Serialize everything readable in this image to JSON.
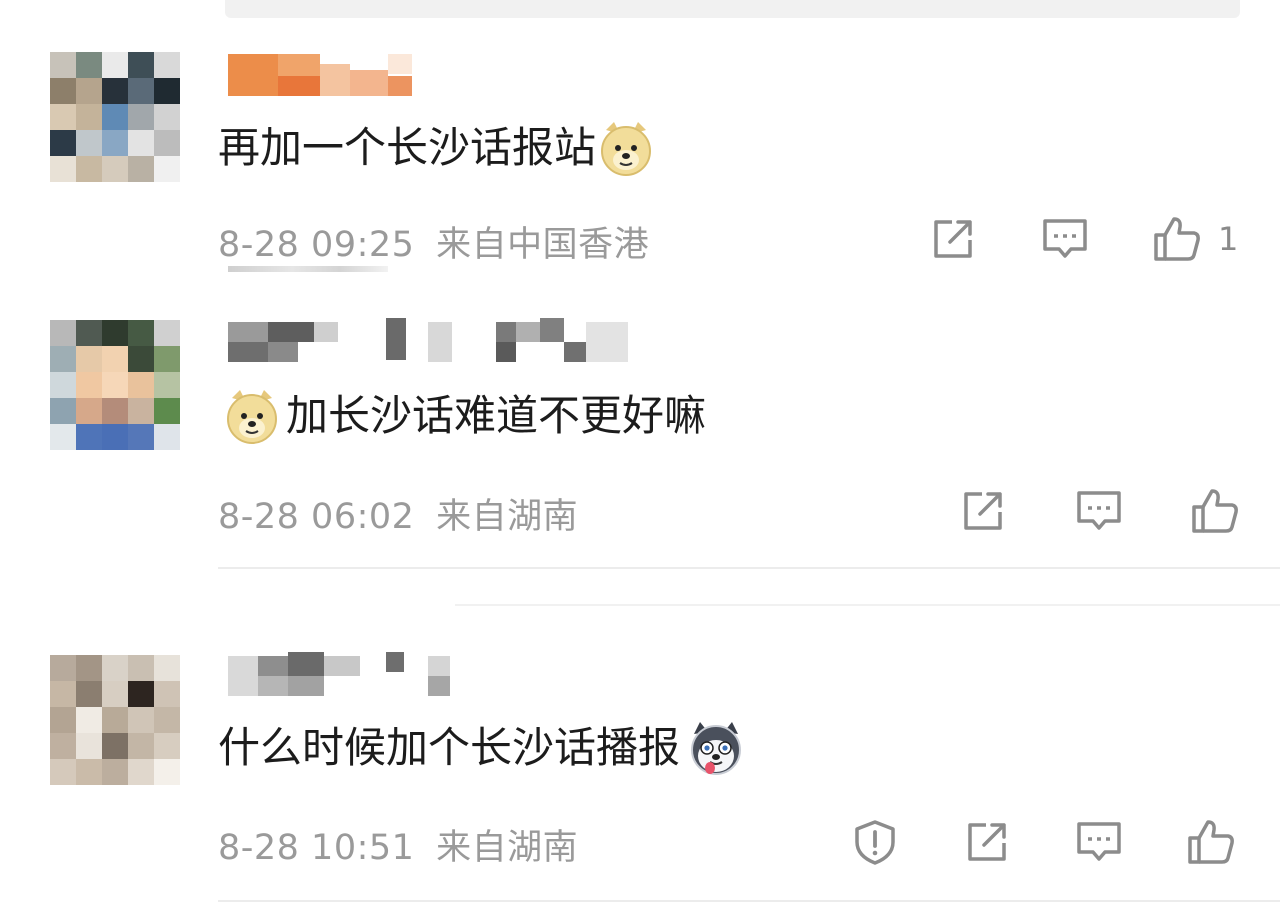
{
  "comments": [
    {
      "text_before_emoji": "再加一个长沙话报站",
      "text_after_emoji": "",
      "emoji": "doge-emoji",
      "timestamp": "8-28 09:25",
      "location": "来自中国香港",
      "like_count": "1",
      "icons": [
        "share-icon",
        "comment-icon",
        "like-icon"
      ]
    },
    {
      "text_before_emoji": "",
      "text_after_emoji": "加长沙话难道不更好嘛",
      "emoji": "doge-emoji",
      "timestamp": "8-28 06:02",
      "location": "来自湖南",
      "like_count": "",
      "icons": [
        "share-icon",
        "comment-icon",
        "like-icon"
      ]
    },
    {
      "text_before_emoji": "什么时候加个长沙话播报",
      "text_after_emoji": "",
      "emoji": "husky-emoji",
      "timestamp": "8-28 10:51",
      "location": "来自湖南",
      "like_count": "",
      "icons": [
        "report-icon",
        "share-icon",
        "comment-icon",
        "like-icon"
      ]
    }
  ],
  "colors": {
    "text": "#1c1c1c",
    "meta": "#9a9a9a",
    "icon": "#8c8c8c",
    "divider": "#ececec"
  }
}
